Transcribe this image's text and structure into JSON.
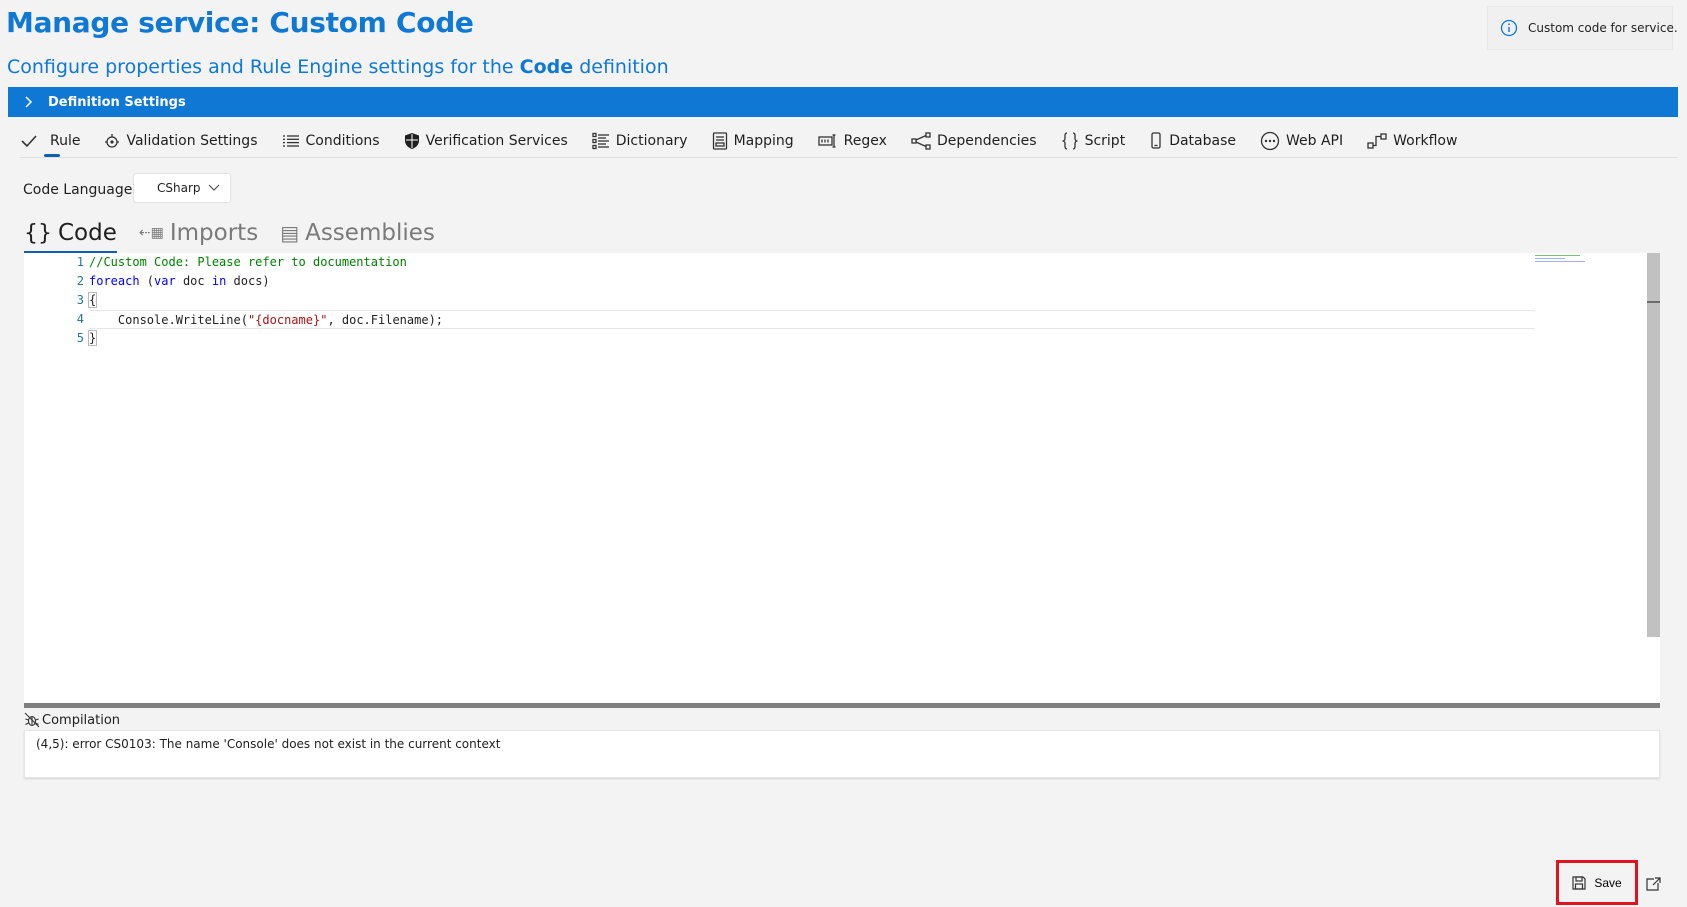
{
  "header": {
    "title": "Manage service:  Custom Code",
    "subtitle_prefix": "Configure properties and Rule Engine settings for the ",
    "subtitle_bold": "Code",
    "subtitle_suffix": " definition",
    "info_text": "Custom code for service."
  },
  "definition_bar": {
    "label": "Definition Settings"
  },
  "toolbar": {
    "items": [
      {
        "label": "Rule",
        "icon": "check-icon",
        "active": true
      },
      {
        "label": "Validation Settings",
        "icon": "validation-icon"
      },
      {
        "label": "Conditions",
        "icon": "list-icon"
      },
      {
        "label": "Verification Services",
        "icon": "shield-icon"
      },
      {
        "label": "Dictionary",
        "icon": "dictionary-icon"
      },
      {
        "label": "Mapping",
        "icon": "mapping-icon"
      },
      {
        "label": "Regex",
        "icon": "regex-icon"
      },
      {
        "label": "Dependencies",
        "icon": "dependencies-icon"
      },
      {
        "label": "Script",
        "icon": "braces-icon"
      },
      {
        "label": "Database",
        "icon": "database-icon"
      },
      {
        "label": "Web API",
        "icon": "web-api-icon"
      },
      {
        "label": "Workflow",
        "icon": "workflow-icon"
      }
    ]
  },
  "language": {
    "label": "Code Language:",
    "selected": "CSharp"
  },
  "code_tabs": [
    {
      "label": "Code",
      "icon": "{}",
      "active": true
    },
    {
      "label": "Imports",
      "icon": "⇠▦"
    },
    {
      "label": "Assemblies",
      "icon": "▤"
    }
  ],
  "editor": {
    "line_numbers": [
      "1",
      "2",
      "3",
      "4",
      "5"
    ],
    "lines": {
      "l1_comment": "//Custom Code: Please refer to documentation",
      "l2_kw1": "foreach",
      "l2_a": " (",
      "l2_kw2": "var",
      "l2_b": " doc ",
      "l2_kw3": "in",
      "l2_c": " docs)",
      "l3": "{",
      "l4_a": "    Console.WriteLine(",
      "l4_str": "\"{docname}\"",
      "l4_b": ", doc.Filename);",
      "l5": "}"
    }
  },
  "compilation": {
    "title": "Compilation",
    "message": "(4,5): error CS0103: The name 'Console' does not exist in the current context"
  },
  "footer": {
    "save_label": "Save"
  },
  "colors": {
    "accent": "#0f78d4",
    "highlight": "#e0141e"
  }
}
